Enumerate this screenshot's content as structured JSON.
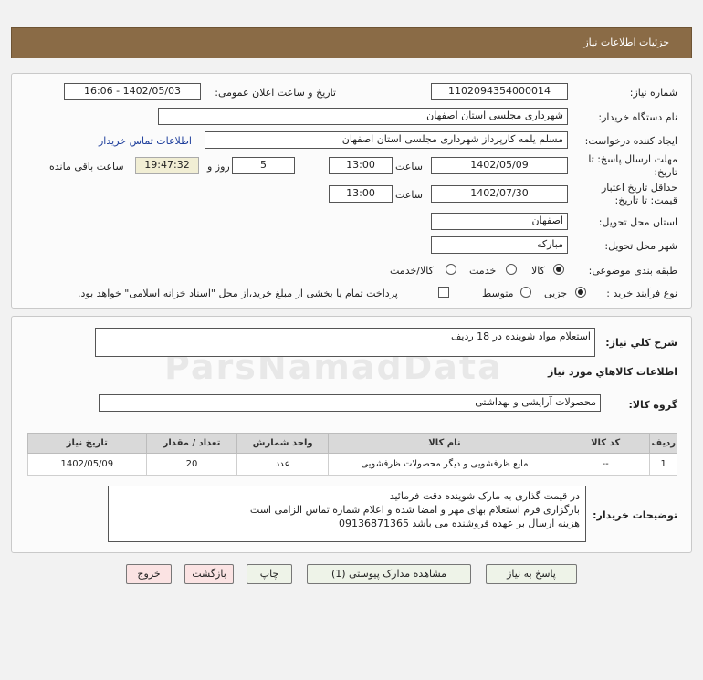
{
  "header": {
    "title": "جزئیات اطلاعات نیاز"
  },
  "form": {
    "need_number_label": "شماره نیاز:",
    "need_number": "1102094354000014",
    "announce_label": "تاریخ و ساعت اعلان عمومی:",
    "announce_value": "1402/05/03 - 16:06",
    "buyer_org_label": "نام دستگاه خریدار:",
    "buyer_org": "شهرداری مجلسی استان اصفهان",
    "creator_label": "ایجاد کننده درخواست:",
    "creator": "مسلم یلمه کارپرداز شهرداری مجلسی استان اصفهان",
    "contact_link": "اطلاعات تماس خریدار",
    "reply_deadline_label_1": "مهلت ارسال پاسخ: تا",
    "reply_deadline_label_2": "تاریخ:",
    "reply_date": "1402/05/09",
    "time_label": "ساعت",
    "reply_time": "13:00",
    "days_value": "5",
    "days_label": "روز و",
    "remaining_time": "19:47:32",
    "remaining_label": "ساعت باقی مانده",
    "price_validity_label_1": "حداقل تاریخ اعتبار",
    "price_validity_label_2": "قیمت: تا تاریخ:",
    "validity_date": "1402/07/30",
    "validity_time": "13:00",
    "delivery_province_label": "استان محل تحویل:",
    "delivery_province": "اصفهان",
    "delivery_city_label": "شهر محل تحویل:",
    "delivery_city": "مبارکه",
    "category_label": "طبقه بندی موضوعی:",
    "category_options": [
      "کالا",
      "خدمت",
      "کالا/خدمت"
    ],
    "process_label": "نوع فرآیند خرید :",
    "process_options": [
      "جزیی",
      "متوسط"
    ],
    "payment_note": "پرداخت تمام یا بخشی از مبلغ خرید،از محل \"اسناد خزانه اسلامی\" خواهد بود."
  },
  "summary": {
    "title": "شرح کلي نياز:",
    "value": "استعلام مواد شوینده در 18 ردیف",
    "goods_info_title": "اطلاعات کالاهاي مورد نياز",
    "group_label": "گروه کالا:",
    "group_value": "محصولات آرایشی و بهداشتی"
  },
  "table": {
    "headers": [
      "ردیف",
      "کد کالا",
      "نام کالا",
      "واحد شمارش",
      "تعداد / مقدار",
      "تاریخ نیاز"
    ],
    "rows": [
      [
        "1",
        "--",
        "مایع ظرفشویی و دیگر محصولات ظرفشویی",
        "عدد",
        "20",
        "1402/05/09"
      ]
    ]
  },
  "notes": {
    "label": "توضیحات خریدار:",
    "lines": [
      "در قیمت گذاری به مارک شوینده دقت فرمائید",
      "بارگزاری فرم استعلام بهای مهر و امضا شده و اعلام شماره تماس الزامی است",
      "هزینه ارسال بر عهده فروشنده می باشد 09136871365"
    ]
  },
  "buttons": {
    "reply": "پاسخ به نیاز",
    "attachments": "مشاهده مدارک پیوستی (1)",
    "print": "چاپ",
    "back": "بازگشت",
    "exit": "خروج"
  },
  "watermark": "ParsNamadData",
  "colors": {
    "header_bg": "#8a6b46",
    "link": "#1f3f9c",
    "remaining_bg": "#f1eed4"
  }
}
